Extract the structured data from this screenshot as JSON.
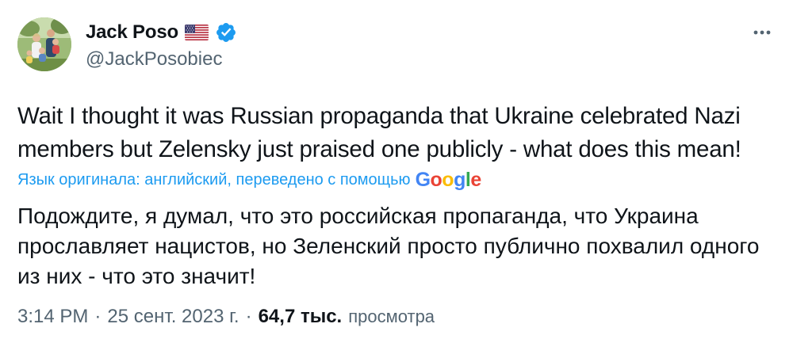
{
  "author": {
    "display_name": "Jack Poso",
    "flag_icon": "us-flag-icon",
    "verified_icon": "verified-badge-icon",
    "handle": "@JackPosobiec",
    "badge_color": "#1d9bf0"
  },
  "tweet": {
    "text": "Wait I thought it was Russian propaganda that Ukraine celebrated Nazi members but Zelensky just praised one publicly - what does this mean!",
    "translation_note": "Язык оригинала: английский, переведено с помощью",
    "translation_provider": "Google",
    "translated_text": "Подождите, я думал, что это российская пропаганда, что Украина прославляет нацистов, но Зеленский просто публично похвалил одного из них - что это значит!"
  },
  "meta": {
    "time": "3:14 PM",
    "separator": "·",
    "date": "25 сент. 2023 г.",
    "views_count": "64,7 тыс.",
    "views_label": "просмотра"
  },
  "more_icon": "more-dots-icon"
}
